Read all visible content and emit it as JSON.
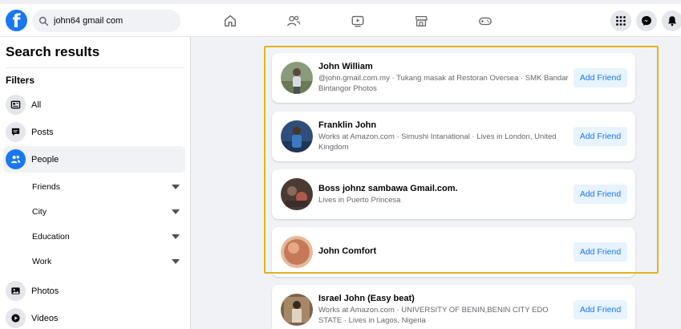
{
  "search": {
    "value": "john64 gmail com"
  },
  "sidebar": {
    "title": "Search results",
    "filters_label": "Filters",
    "items": [
      {
        "label": "All",
        "icon": "newsfeed-icon"
      },
      {
        "label": "Posts",
        "icon": "chat-bubble-icon"
      },
      {
        "label": "People",
        "icon": "people-icon",
        "active": true
      },
      {
        "label": "Photos",
        "icon": "photo-icon"
      },
      {
        "label": "Videos",
        "icon": "play-icon"
      }
    ],
    "subfilters": [
      {
        "label": "Friends"
      },
      {
        "label": "City"
      },
      {
        "label": "Education"
      },
      {
        "label": "Work"
      }
    ]
  },
  "results": [
    {
      "name": "John William",
      "meta": "@john.gmail.com.my · Tukang masak at Restoran Oversea · SMK Bandar Bintangor Photos",
      "button": "Add Friend"
    },
    {
      "name": "Franklin John",
      "meta": "Works at Amazon.com · Simushi Intanational · Lives in London, United Kingdom",
      "button": "Add Friend"
    },
    {
      "name": "Boss johnz sambawa Gmail.com.",
      "meta": "Lives in Puerto Princesa",
      "button": "Add Friend"
    },
    {
      "name": "John Comfort",
      "meta": "",
      "button": "Add Friend"
    },
    {
      "name": "Israel John (Easy beat)",
      "meta": "Works at Amazon.com · UNIVERSITY OF BENIN,BENIN CITY EDO STATE · Lives in Lagos, Nigeria",
      "button": "Add Friend"
    }
  ],
  "colors": {
    "brand": "#1877f2",
    "highlight": "#e2b31f",
    "button_bg": "#e7f3ff"
  }
}
